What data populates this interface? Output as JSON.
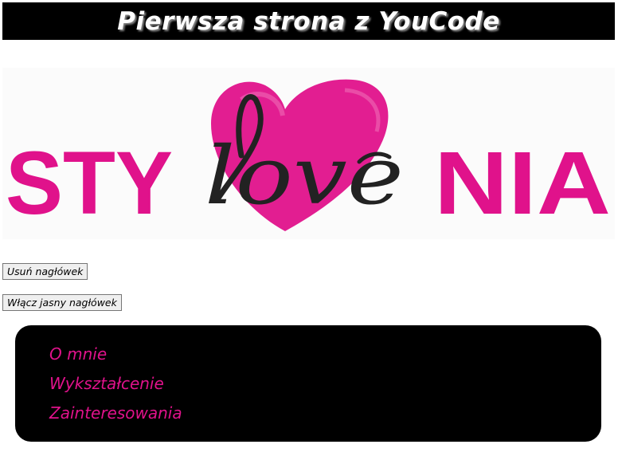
{
  "header": {
    "title": "Pierwsza strona z YouCode"
  },
  "logo": {
    "text_left": "STY",
    "text_script": "love",
    "text_right": "NIA",
    "colors": {
      "pink": "#e0128b",
      "dark": "#222222"
    }
  },
  "buttons": {
    "remove_header": "Usuń nagłówek",
    "light_header": "Włącz jasny nagłówek"
  },
  "nav": {
    "items": [
      {
        "label": "O mnie"
      },
      {
        "label": "Wykształcenie"
      },
      {
        "label": "Zainteresowania"
      }
    ]
  },
  "colors": {
    "header_bg": "#000000",
    "header_text": "#ffffff",
    "nav_bg": "#000000",
    "nav_text": "#e0128b"
  }
}
